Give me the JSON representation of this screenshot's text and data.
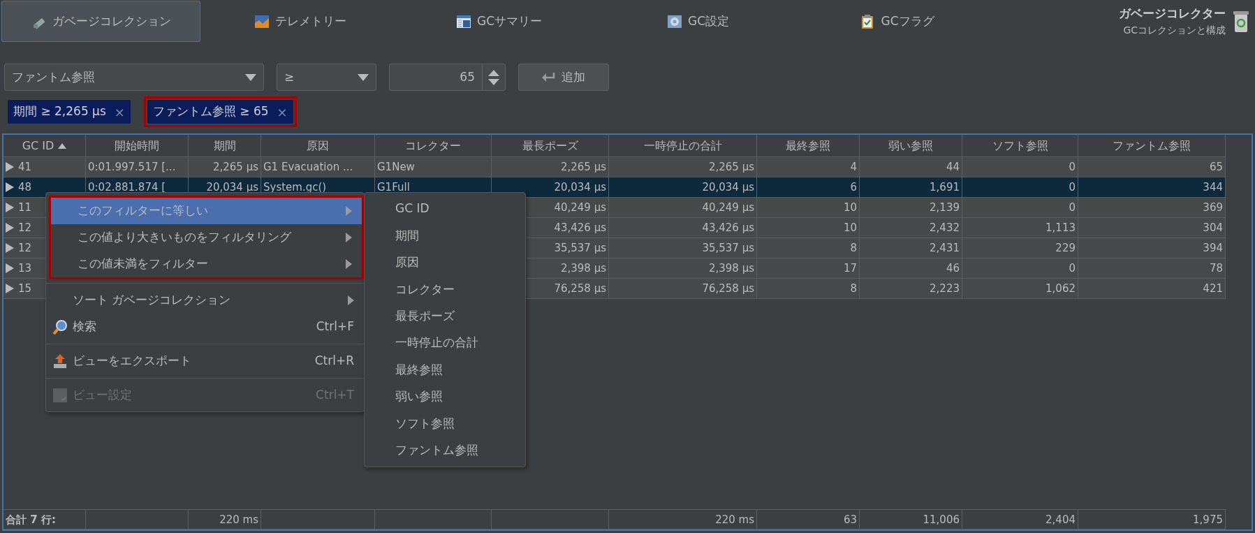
{
  "tabs": [
    {
      "label": "ガベージコレクション",
      "selected": true
    },
    {
      "label": "テレメトリー",
      "selected": false
    },
    {
      "label": "GCサマリー",
      "selected": false
    },
    {
      "label": "GC設定",
      "selected": false
    },
    {
      "label": "GCフラグ",
      "selected": false
    }
  ],
  "header": {
    "title": "ガベージコレクター",
    "subtitle": "GCコレクションと構成"
  },
  "filter_bar": {
    "field": "ファントム参照",
    "operator": "≥",
    "value": "65",
    "add_button": "追加"
  },
  "filters": [
    {
      "label": "期間 ≥ 2,265 µs",
      "close": "×",
      "annotated": false
    },
    {
      "label": "ファントム参照 ≥ 65",
      "close": "×",
      "annotated": true
    }
  ],
  "table": {
    "columns": [
      {
        "label": "GC ID",
        "sorted": true
      },
      {
        "label": "開始時間",
        "sorted": false
      },
      {
        "label": "期間",
        "sorted": false
      },
      {
        "label": "原因",
        "sorted": false
      },
      {
        "label": "コレクター",
        "sorted": false
      },
      {
        "label": "最長ポーズ",
        "sorted": false
      },
      {
        "label": "一時停止の合計",
        "sorted": false
      },
      {
        "label": "最終参照",
        "sorted": false
      },
      {
        "label": "弱い参照",
        "sorted": false
      },
      {
        "label": "ソフト参照",
        "sorted": false
      },
      {
        "label": "ファントム参照",
        "sorted": false
      }
    ],
    "rows": [
      {
        "selected": false,
        "cells": [
          "41",
          "0:01.997.517 [...",
          "2,265 µs",
          "G1 Evacuation ...",
          "G1New",
          "2,265 µs",
          "2,265 µs",
          "4",
          "44",
          "0",
          "65"
        ]
      },
      {
        "selected": true,
        "cells": [
          "48",
          "0:02.881.874 [",
          "20,034 µs",
          "System.gc()",
          "G1Full",
          "20,034 µs",
          "20,034 µs",
          "6",
          "1,691",
          "0",
          "344"
        ]
      },
      {
        "selected": false,
        "cells": [
          "11",
          null,
          null,
          null,
          null,
          "40,249 µs",
          "40,249 µs",
          "10",
          "2,139",
          "0",
          "369"
        ]
      },
      {
        "selected": false,
        "cells": [
          "12",
          null,
          null,
          null,
          null,
          "43,426 µs",
          "43,426 µs",
          "10",
          "2,432",
          "1,113",
          "304"
        ]
      },
      {
        "selected": false,
        "cells": [
          "12",
          null,
          null,
          null,
          null,
          "35,537 µs",
          "35,537 µs",
          "8",
          "2,431",
          "229",
          "394"
        ]
      },
      {
        "selected": false,
        "cells": [
          "13",
          null,
          null,
          null,
          null,
          "2,398 µs",
          "2,398 µs",
          "17",
          "46",
          "0",
          "78"
        ]
      },
      {
        "selected": false,
        "cells": [
          "15",
          null,
          null,
          null,
          null,
          "76,258 µs",
          "76,258 µs",
          "8",
          "2,223",
          "1,062",
          "421"
        ]
      }
    ],
    "footer": {
      "label": "合計 7 行:",
      "duration": "220 ms",
      "total_pause": "220 ms",
      "final": "63",
      "weak": "11,006",
      "soft": "2,404",
      "phantom": "1,975"
    }
  },
  "context_menu": {
    "items": [
      {
        "kind": "submenu",
        "label": "このフィルターに等しい",
        "selected": true,
        "annotated": true
      },
      {
        "kind": "submenu",
        "label": "この値より大きいものをフィルタリング",
        "selected": false,
        "annotated": true
      },
      {
        "kind": "submenu",
        "label": "この値未満をフィルター",
        "selected": false,
        "annotated": true
      },
      {
        "kind": "separator"
      },
      {
        "kind": "submenu",
        "label": "ソート ガベージコレクション",
        "selected": false,
        "annotated": false
      },
      {
        "kind": "command",
        "label": "検索",
        "shortcut": "Ctrl+F",
        "disabled": false
      },
      {
        "kind": "separator"
      },
      {
        "kind": "command",
        "label": "ビューをエクスポート",
        "shortcut": "Ctrl+R",
        "disabled": false
      },
      {
        "kind": "separator"
      },
      {
        "kind": "command",
        "label": "ビュー設定",
        "shortcut": "Ctrl+T",
        "disabled": true
      }
    ]
  },
  "submenu": {
    "items": [
      "GC ID",
      "期間",
      "原因",
      "コレクター",
      "最長ポーズ",
      "一時停止の合計",
      "最終参照",
      "弱い参照",
      "ソフト参照",
      "ファントム参照"
    ]
  }
}
